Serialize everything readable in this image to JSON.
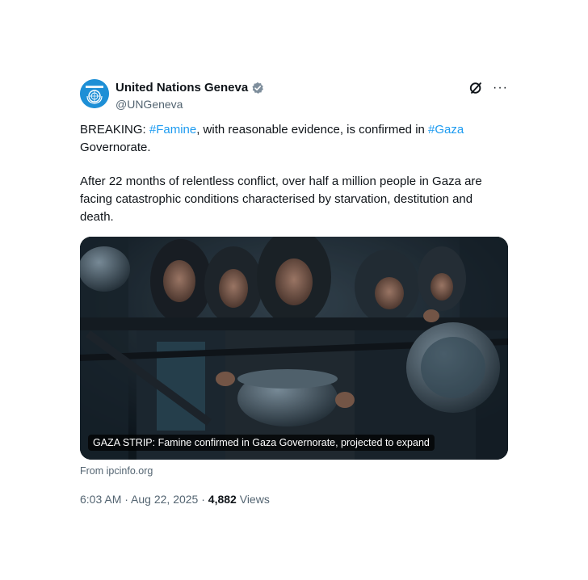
{
  "account": {
    "display_name": "United Nations Geneva",
    "handle": "@UNGeneva",
    "avatar_icon": "un-emblem-icon",
    "verified_icon": "verified-badge-icon",
    "brand_color": "#1d8fd6"
  },
  "actions": {
    "grok_icon": "grok-icon",
    "more_icon": "more-options-icon",
    "more_glyph": "···"
  },
  "tweet": {
    "p1_prefix": "BREAKING: ",
    "p1_tag1": "#Famine",
    "p1_mid": ", with reasonable evidence, is confirmed in ",
    "p1_tag2": "#Gaza",
    "p1_suffix": " Governorate.",
    "p2": "After 22 months of relentless conflict, over half a million people in Gaza are facing catastrophic conditions characterised by starvation, destitution and death.",
    "hashtag_color": "#1d9bf0"
  },
  "card": {
    "caption": "GAZA STRIP: Famine confirmed in Gaza Governorate, projected to expand",
    "source": "From ipcinfo.org"
  },
  "meta": {
    "time": "6:03 AM",
    "sep": " · ",
    "date": "Aug 22, 2025",
    "views_count": "4,882",
    "views_label": " Views"
  }
}
